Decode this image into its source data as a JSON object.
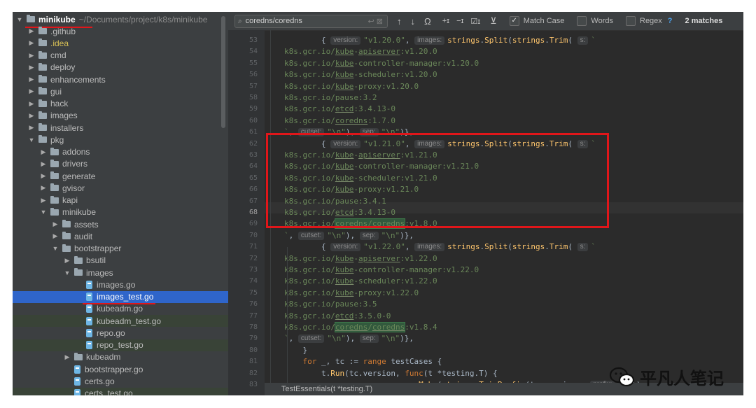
{
  "project": {
    "root_name": "minikube",
    "root_path": "~/Documents/project/k8s/minikube",
    "items": [
      {
        "label": ".github",
        "kind": "folder",
        "depth": 1,
        "expanded": false
      },
      {
        "label": ".idea",
        "kind": "folder",
        "depth": 1,
        "expanded": false,
        "color": "#d6bf55"
      },
      {
        "label": "cmd",
        "kind": "folder",
        "depth": 1,
        "expanded": false
      },
      {
        "label": "deploy",
        "kind": "folder",
        "depth": 1,
        "expanded": false
      },
      {
        "label": "enhancements",
        "kind": "folder",
        "depth": 1,
        "expanded": false
      },
      {
        "label": "gui",
        "kind": "folder",
        "depth": 1,
        "expanded": false
      },
      {
        "label": "hack",
        "kind": "folder",
        "depth": 1,
        "expanded": false
      },
      {
        "label": "images",
        "kind": "folder",
        "depth": 1,
        "expanded": false
      },
      {
        "label": "installers",
        "kind": "folder",
        "depth": 1,
        "expanded": false
      },
      {
        "label": "pkg",
        "kind": "folder",
        "depth": 1,
        "expanded": true
      },
      {
        "label": "addons",
        "kind": "folder",
        "depth": 2,
        "expanded": false
      },
      {
        "label": "drivers",
        "kind": "folder",
        "depth": 2,
        "expanded": false
      },
      {
        "label": "generate",
        "kind": "folder",
        "depth": 2,
        "expanded": false
      },
      {
        "label": "gvisor",
        "kind": "folder",
        "depth": 2,
        "expanded": false
      },
      {
        "label": "kapi",
        "kind": "folder",
        "depth": 2,
        "expanded": false
      },
      {
        "label": "minikube",
        "kind": "folder",
        "depth": 2,
        "expanded": true
      },
      {
        "label": "assets",
        "kind": "folder",
        "depth": 3,
        "expanded": false
      },
      {
        "label": "audit",
        "kind": "folder",
        "depth": 3,
        "expanded": false
      },
      {
        "label": "bootstrapper",
        "kind": "folder",
        "depth": 3,
        "expanded": true
      },
      {
        "label": "bsutil",
        "kind": "folder",
        "depth": 4,
        "expanded": false
      },
      {
        "label": "images",
        "kind": "folder",
        "depth": 4,
        "expanded": true
      },
      {
        "label": "images.go",
        "kind": "file",
        "depth": 5
      },
      {
        "label": "images_test.go",
        "kind": "file",
        "depth": 5,
        "selected": true,
        "underlined": true
      },
      {
        "label": "kubeadm.go",
        "kind": "file",
        "depth": 5
      },
      {
        "label": "kubeadm_test.go",
        "kind": "file",
        "depth": 5,
        "tinted": true
      },
      {
        "label": "repo.go",
        "kind": "file",
        "depth": 5
      },
      {
        "label": "repo_test.go",
        "kind": "file",
        "depth": 5,
        "tinted": true
      },
      {
        "label": "kubeadm",
        "kind": "folder",
        "depth": 4,
        "expanded": false
      },
      {
        "label": "bootstrapper.go",
        "kind": "file",
        "depth": 4
      },
      {
        "label": "certs.go",
        "kind": "file",
        "depth": 4
      },
      {
        "label": "certs_test.go",
        "kind": "file",
        "depth": 4,
        "tinted": true
      }
    ]
  },
  "find": {
    "query": "coredns/coredns",
    "match_case_label": "Match Case",
    "match_case": true,
    "words_label": "Words",
    "words": false,
    "regex_label": "Regex",
    "regex": false,
    "help": "?",
    "matches": "2 matches"
  },
  "editor": {
    "current_line": "68",
    "breadcrumb": "TestEssentials(t *testing.T)",
    "lines": [
      {
        "n": "53",
        "html": "        { <span class='hint'>version:</span><span class='s'>\"v1.20.0\"</span>, <span class='hint'>images:</span><span class='f'>strings</span>.<span class='f'>Split</span>(<span class='f'>strings</span>.<span class='f'>Trim</span>( <span class='hint'>s:</span><span class='s'>`</span>"
      },
      {
        "n": "54",
        "html": "<span class='s'>k8s.gcr.io/<span class='u'>kube</span>-<span class='u'>apiserver</span>:v1.20.0</span>"
      },
      {
        "n": "55",
        "html": "<span class='s'>k8s.gcr.io/<span class='u'>kube</span>-controller-manager:v1.20.0</span>"
      },
      {
        "n": "56",
        "html": "<span class='s'>k8s.gcr.io/<span class='u'>kube</span>-scheduler:v1.20.0</span>"
      },
      {
        "n": "57",
        "html": "<span class='s'>k8s.gcr.io/<span class='u'>kube</span>-proxy:v1.20.0</span>"
      },
      {
        "n": "58",
        "html": "<span class='s'>k8s.gcr.io/pause:3.2</span>"
      },
      {
        "n": "59",
        "html": "<span class='s'>k8s.gcr.io/<span class='u'>etcd</span>:3.4.13-0</span>"
      },
      {
        "n": "60",
        "html": "<span class='s'>k8s.gcr.io/<span class='u'>coredns</span>:1.7.0</span>"
      },
      {
        "n": "61",
        "html": "<span class='s'>`</span>, <span class='hint'>cutset:</span><span class='s'>\"\\n\"</span>), <span class='hint'>sep:</span><span class='s'>\"\\n\"</span>)},"
      },
      {
        "n": "62",
        "html": "        { <span class='hint'>version:</span><span class='s'>\"v1.21.0\"</span>, <span class='hint'>images:</span><span class='f'>strings</span>.<span class='f'>Split</span>(<span class='f'>strings</span>.<span class='f'>Trim</span>( <span class='hint'>s:</span><span class='s'>`</span>"
      },
      {
        "n": "63",
        "html": "<span class='s'>k8s.gcr.io/<span class='u'>kube</span>-<span class='u'>apiserver</span>:v1.21.0</span>"
      },
      {
        "n": "64",
        "html": "<span class='s'>k8s.gcr.io/<span class='u'>kube</span>-controller-manager:v1.21.0</span>"
      },
      {
        "n": "65",
        "html": "<span class='s'>k8s.gcr.io/<span class='u'>kube</span>-scheduler:v1.21.0</span>"
      },
      {
        "n": "66",
        "html": "<span class='s'>k8s.gcr.io/<span class='u'>kube</span>-proxy:v1.21.0</span>"
      },
      {
        "n": "67",
        "html": "<span class='s'>k8s.gcr.io/pause:3.4.1</span>"
      },
      {
        "n": "68",
        "html": "<span class='s'>k8s.gcr.io/<span class='u'>etcd</span>:3.4.13-0</span>"
      },
      {
        "n": "69",
        "html": "<span class='s'>k8s.gcr.io/<span class='m'><span class='u'>coredns</span>/<span class='u'>coredns</span></span>:v1.8.0</span>"
      },
      {
        "n": "70",
        "html": "<span class='s'>`</span>, <span class='hint'>cutset:</span><span class='s'>\"\\n\"</span>), <span class='hint'>sep:</span><span class='s'>\"\\n\"</span>)},"
      },
      {
        "n": "71",
        "html": "        { <span class='hint'>version:</span><span class='s'>\"v1.22.0\"</span>, <span class='hint'>images:</span><span class='f'>strings</span>.<span class='f'>Split</span>(<span class='f'>strings</span>.<span class='f'>Trim</span>( <span class='hint'>s:</span><span class='s'>`</span>"
      },
      {
        "n": "72",
        "html": "<span class='s'>k8s.gcr.io/<span class='u'>kube</span>-<span class='u'>apiserver</span>:v1.22.0</span>"
      },
      {
        "n": "73",
        "html": "<span class='s'>k8s.gcr.io/<span class='u'>kube</span>-controller-manager:v1.22.0</span>"
      },
      {
        "n": "74",
        "html": "<span class='s'>k8s.gcr.io/<span class='u'>kube</span>-scheduler:v1.22.0</span>"
      },
      {
        "n": "75",
        "html": "<span class='s'>k8s.gcr.io/<span class='u'>kube</span>-proxy:v1.22.0</span>"
      },
      {
        "n": "76",
        "html": "<span class='s'>k8s.gcr.io/pause:3.5</span>"
      },
      {
        "n": "77",
        "html": "<span class='s'>k8s.gcr.io/<span class='u'>etcd</span>:3.5.0-0</span>"
      },
      {
        "n": "78",
        "html": "<span class='s'>k8s.gcr.io/<span class='m'><span class='u'>coredns</span>/<span class='u'>coredns</span></span>:v1.8.4</span>"
      },
      {
        "n": "79",
        "html": "<span class='s'>`</span>, <span class='hint'>cutset:</span><span class='s'>\"\\n\"</span>), <span class='hint'>sep:</span><span class='s'>\"\\n\"</span>)},"
      },
      {
        "n": "80",
        "html": "    }"
      },
      {
        "n": "81",
        "html": "    <span class='k'>for</span> _, tc := <span class='k'>range</span> testCases {"
      },
      {
        "n": "82",
        "html": "        t.<span class='f'>Run</span>(tc.version, <span class='k'>func</span>(t *testing.T) {"
      },
      {
        "n": "83",
        "html": "            v, err := <span class='fnr'>semver</span>.<span class='f'>Make</span>(<span class='f'>strings</span>.<span class='f'>TrimPrefix</span>(tc.version,  <span class='hint'>prefix:</span><span class='s'>\"v\"</span>))"
      }
    ]
  },
  "watermark": {
    "text": "平凡人笔记",
    "icon": "wechat-icon"
  }
}
